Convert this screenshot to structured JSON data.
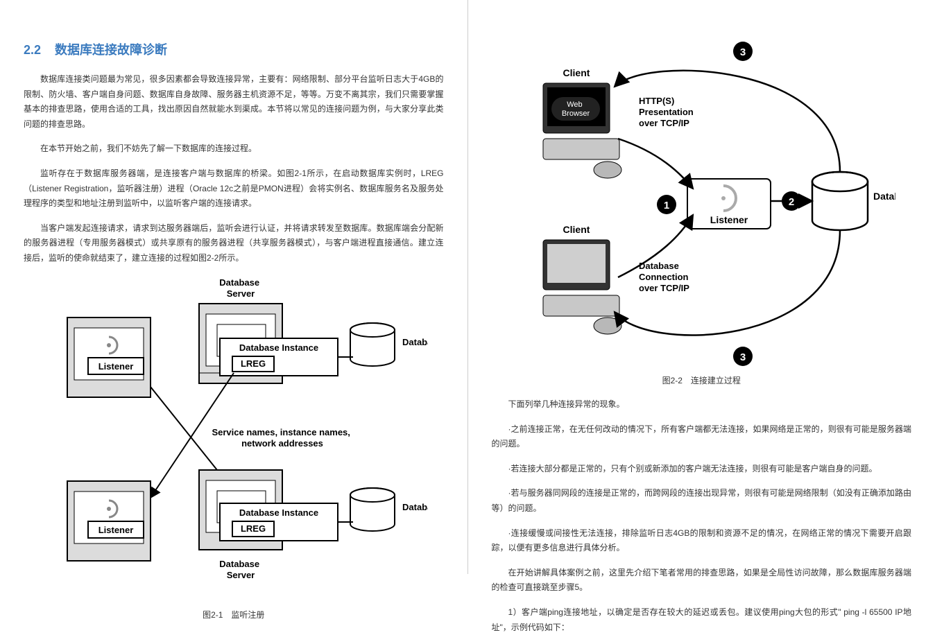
{
  "left": {
    "section_num": "2.2",
    "section_title": "数据库连接故障诊断",
    "p1": "数据库连接类问题最为常见，很多因素都会导致连接异常，主要有：网络限制、部分平台监听日志大于4GB的限制、防火墙、客户端自身问题、数据库自身故障、服务器主机资源不足，等等。万变不离其宗，我们只需要掌握基本的排查思路，使用合适的工具，找出原因自然就能水到渠成。本节将以常见的连接问题为例，与大家分享此类问题的排查思路。",
    "p2": "在本节开始之前，我们不妨先了解一下数据库的连接过程。",
    "p3": "监听存在于数据库服务器端，是连接客户端与数据库的桥梁。如图2-1所示，在启动数据库实例时，LREG（Listener Registration，监听器注册）进程（Oracle 12c之前是PMON进程）会将实例名、数据库服务名及服务处理程序的类型和地址注册到监听中，以监听客户端的连接请求。",
    "p4": "当客户端发起连接请求，请求到达服务器端后，监听会进行认证，并将请求转发至数据库。数据库端会分配新的服务器进程（专用服务器模式）或共享原有的服务器进程（共享服务器模式），与客户端进程直接通信。建立连接后，监听的使命就结束了，建立连接的过程如图2-2所示。",
    "fig1": {
      "db_server": "Database\nServer",
      "db_instance": "Database Instance",
      "lreg": "LREG",
      "listener": "Listener",
      "database": "Database",
      "svc": "Service names, instance names,\nnetwork addresses",
      "caption": "图2-1　监听注册"
    }
  },
  "right": {
    "fig2": {
      "client": "Client",
      "web_browser": "Web\nBrowser",
      "listener": "Listener",
      "database": "Database",
      "https": "HTTP(S)\nPresentation\nover TCP/IP",
      "dbconn": "Database\nConnection\nover TCP/IP",
      "n1": "1",
      "n2": "2",
      "n3": "3",
      "caption": "图2-2　连接建立过程"
    },
    "p1": "下面列举几种连接异常的现象。",
    "p2": "·之前连接正常，在无任何改动的情况下，所有客户端都无法连接，如果网络是正常的，则很有可能是服务器端的问题。",
    "p3": "·若连接大部分都是正常的，只有个别或新添加的客户端无法连接，则很有可能是客户端自身的问题。",
    "p4": "·若与服务器同网段的连接是正常的，而跨网段的连接出现异常，则很有可能是网络限制（如没有正确添加路由等）的问题。",
    "p5": "·连接缓慢或间接性无法连接，排除监听日志4GB的限制和资源不足的情况，在网络正常的情况下需要开启跟踪，以便有更多信息进行具体分析。",
    "p6": "在开始讲解具体案例之前，这里先介绍下笔者常用的排查思路，如果是全局性访问故障，那么数据库服务器端的检查可直接跳至步骤5。",
    "p7": "1）客户端ping连接地址，以确定是否存在较大的延迟或丢包。建议使用ping大包的形式\" ping -l 65500 IP地址\"，示例代码如下："
  }
}
